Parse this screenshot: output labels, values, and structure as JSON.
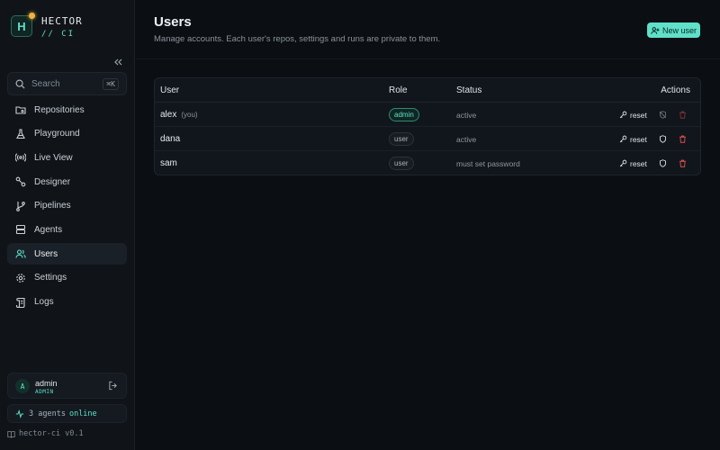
{
  "brand": {
    "initial": "H",
    "name": "HECTOR",
    "sub": "// CI"
  },
  "search": {
    "placeholder": "Search",
    "shortcut": "⌘K"
  },
  "nav": [
    {
      "label": "Repositories",
      "icon": "folder-git-icon"
    },
    {
      "label": "Playground",
      "icon": "flask-icon"
    },
    {
      "label": "Live View",
      "icon": "radio-icon"
    },
    {
      "label": "Designer",
      "icon": "workflow-icon"
    },
    {
      "label": "Pipelines",
      "icon": "git-branch-icon"
    },
    {
      "label": "Agents",
      "icon": "server-icon"
    },
    {
      "label": "Users",
      "icon": "users-icon",
      "active": true
    },
    {
      "label": "Settings",
      "icon": "gear-icon"
    },
    {
      "label": "Logs",
      "icon": "scroll-icon"
    }
  ],
  "current_user": {
    "avatar": "A",
    "name": "admin",
    "role": "ADMIN"
  },
  "agents_status": {
    "prefix": "3 agents",
    "state": "online"
  },
  "version": "hector-ci v0.1",
  "page": {
    "title": "Users",
    "subtitle": "Manage accounts. Each user's repos, settings and runs are private to them.",
    "new_user_label": "New user"
  },
  "table": {
    "headers": {
      "user": "User",
      "role": "Role",
      "status": "Status",
      "actions": "Actions"
    },
    "reset_label": "reset",
    "rows": [
      {
        "name": "alex",
        "you": "(you)",
        "role": "admin",
        "status": "active"
      },
      {
        "name": "dana",
        "you": "",
        "role": "user",
        "status": "active"
      },
      {
        "name": "sam",
        "you": "",
        "role": "user",
        "status": "must set password"
      }
    ]
  },
  "colors": {
    "accent": "#5fe0c8",
    "danger": "#e0504f",
    "brand_dot": "#f0b43c",
    "background": "#0b0e13"
  }
}
